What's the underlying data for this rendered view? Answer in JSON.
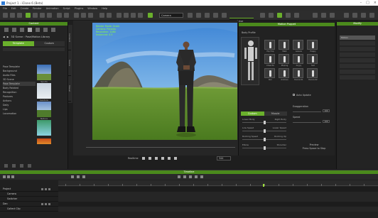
{
  "titlebar": {
    "title": "Project 1 - iClone 6 (Beta)"
  },
  "menu": [
    "File",
    "Edit",
    "Create",
    "Render",
    "Animation",
    "Script",
    "Plugins",
    "Window",
    "Help",
    "Help"
  ],
  "toolbar": {
    "mode": "Camera",
    "actor_tab": "Actor"
  },
  "content": {
    "title": "Content",
    "nav": "3D Scene › Pose/Motion Library",
    "tabs": [
      "Template",
      "Custom"
    ],
    "tree": [
      "Pose Template",
      "Background",
      "Audio Files",
      "3D Scene",
      "Pose Template",
      "Body Related",
      "Recognition",
      "Postures",
      "Actions",
      "Daily",
      "Lips",
      "Locomotion"
    ],
    "thumbs": [
      "Sports",
      "Gesture",
      "Nature",
      "",
      ""
    ]
  },
  "side_tabs": [
    "Content",
    "Scene",
    "Visual"
  ],
  "viewport": {
    "stats": [
      "Render Mode: Quick",
      "Camera: Preview",
      "Resolution: 1080",
      "Instanced: 0.5"
    ]
  },
  "playback": {
    "label": "Realtime",
    "frame": "344"
  },
  "motion_panel": {
    "title": "Motion Puppet",
    "body_parts_label": "Body Profile",
    "poses": [
      "Hip Hop",
      "Walk",
      "Leisure",
      "Happy",
      "Cheerful",
      "Moping",
      "Angry",
      "Sad",
      "Run",
      "Anxious",
      "Dance 01",
      "Dance 02"
    ],
    "tabs": [
      "Custom",
      "Muscle"
    ],
    "sliders": [
      {
        "left": "Lower Body",
        "right": "Right Body"
      },
      {
        "left": "Low Speed",
        "right": "Lower Speed"
      },
      {
        "left": "Rocking Speed",
        "right": "Rocking Up"
      },
      {
        "left": "Elbow",
        "right": "Shoulder"
      },
      {
        "left": "Lower Stride",
        "right": "Stride Range"
      },
      {
        "left": "Bound",
        "right": "Wave Size"
      }
    ],
    "auto_update": "Auto Update",
    "exaggeration": "Exaggeration",
    "speed": "Speed",
    "exaggeration_value": "100",
    "speed_value": "100",
    "preview": "Preview",
    "preview_hint": "Press Space to Stop"
  },
  "modify_panel": {
    "title": "Modify",
    "active": "Motion"
  },
  "timeline": {
    "title": "Timeline",
    "tracks": [
      {
        "name": "Project",
        "header": true
      },
      {
        "name": "Camera",
        "header": false
      },
      {
        "name": "Switcher",
        "header": false
      },
      {
        "name": "Dan",
        "header": true
      },
      {
        "name": "Collect Clip",
        "header": false
      }
    ]
  }
}
